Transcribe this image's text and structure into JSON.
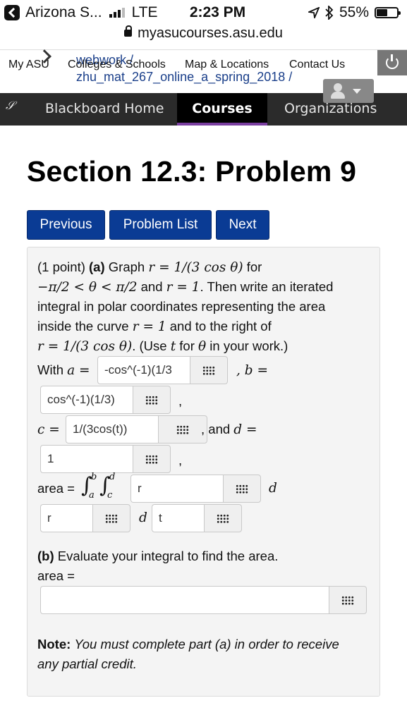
{
  "status": {
    "carrier": "Arizona S...",
    "network": "LTE",
    "time": "2:23 PM",
    "battery": "55%",
    "battery_fill": 0.55
  },
  "url": "myasucourses.asu.edu",
  "asu_nav": {
    "my_asu": "My ASU",
    "crumb_top": "webwork /",
    "colleges": "Colleges & Schools",
    "map": "Map & Locations",
    "contact": "Contact Us",
    "crumb_course": "zhu_mat_267_online_a_spring_2018 /"
  },
  "bb_nav": {
    "home": "Blackboard Home",
    "courses": "Courses",
    "organizations": "Organizations"
  },
  "page_title": "Section 12.3: Problem 9",
  "buttons": {
    "previous": "Previous",
    "problem_list": "Problem List",
    "next": "Next"
  },
  "problem": {
    "points": "(1 point)",
    "part_a": "(a)",
    "graph_word": "Graph",
    "r_eq_1": "r = 1/(3 cos θ)",
    "for_word": "for",
    "range": "−π/2 < θ < π/2",
    "and_word": "and",
    "r_eq_2": "r = 1",
    "line2_rest": ". Then write an iterated",
    "line3": "integral in polar coordinates representing the area",
    "line4_a": "inside the curve",
    "r_eq_3": "r = 1",
    "line4_b": "and to the right of",
    "r_eq_4": "r = 1/(3 cos θ)",
    "line5_b": ". (Use",
    "t_var": "t",
    "line5_c": "for",
    "theta": "θ",
    "line5_d": "in your work.)",
    "with_word": "With",
    "a_eq": "a =",
    "b_eq": ", b =",
    "c_eq": "c =",
    "and_d": ", and",
    "d_eq": "d =",
    "comma": ",",
    "area_word": "area =",
    "int_b": "b",
    "int_a": "a",
    "int_d": "d",
    "int_c": "c",
    "d1": "d",
    "d2": "d",
    "a_value": "-cos^(-1)(1/3",
    "b_value": "cos^(-1)(1/3)",
    "c_value": "1/(3cos(t))",
    "d_value": "1",
    "integrand_value": "r",
    "first_var_value": "r",
    "second_var_value": "t",
    "part_b": "(b)",
    "part_b_text": "Evaluate your integral to find the area.",
    "area_b": "area =",
    "area_b_value": "",
    "note_label": "Note:",
    "note_line1": "You must complete part (a) in order to receive",
    "note_line2": "any partial credit."
  }
}
